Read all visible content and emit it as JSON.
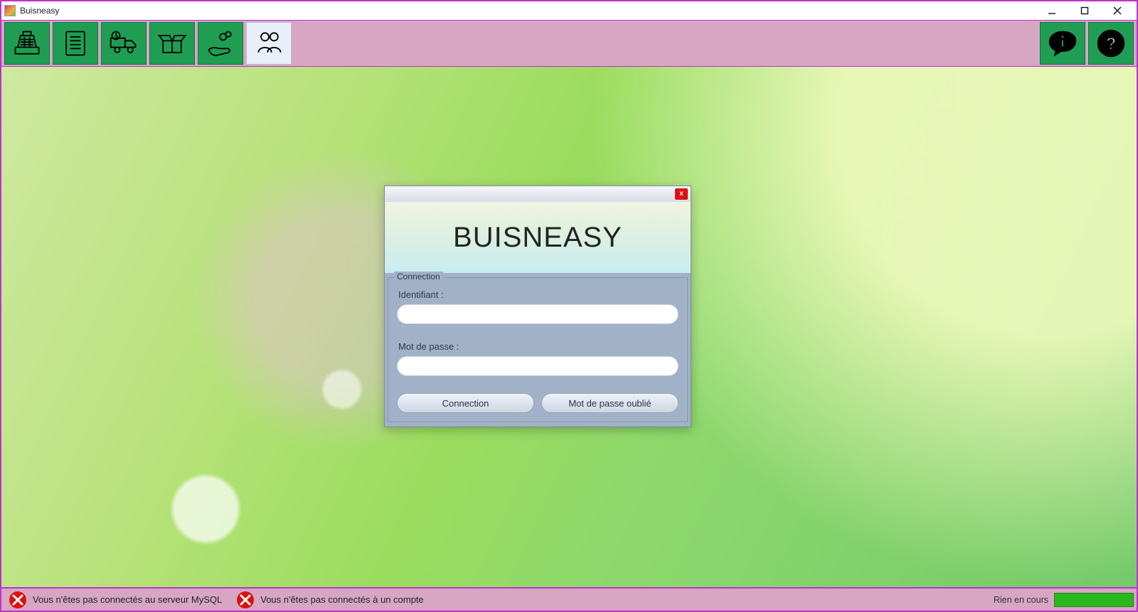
{
  "window": {
    "title": "Buisneasy"
  },
  "toolbar": {
    "items": [
      {
        "name": "cash-register"
      },
      {
        "name": "invoice"
      },
      {
        "name": "delivery"
      },
      {
        "name": "inventory-box"
      },
      {
        "name": "payment-hand"
      },
      {
        "name": "users",
        "active": true
      }
    ]
  },
  "dialog": {
    "brand": "BUISNEASY",
    "group_label": "Connection",
    "id_label": "Identifiant :",
    "id_value": "",
    "pw_label": "Mot de passe :",
    "pw_value": "",
    "connect_btn": "Connection",
    "forgot_btn": "Mot de passe oublié",
    "close_glyph": "x"
  },
  "status": {
    "mysql_msg": "Vous n'êtes pas connectés au serveur MySQL",
    "account_msg": "Vous n'êtes pas connectés à un compte",
    "progress_label": "Rien en cours"
  }
}
